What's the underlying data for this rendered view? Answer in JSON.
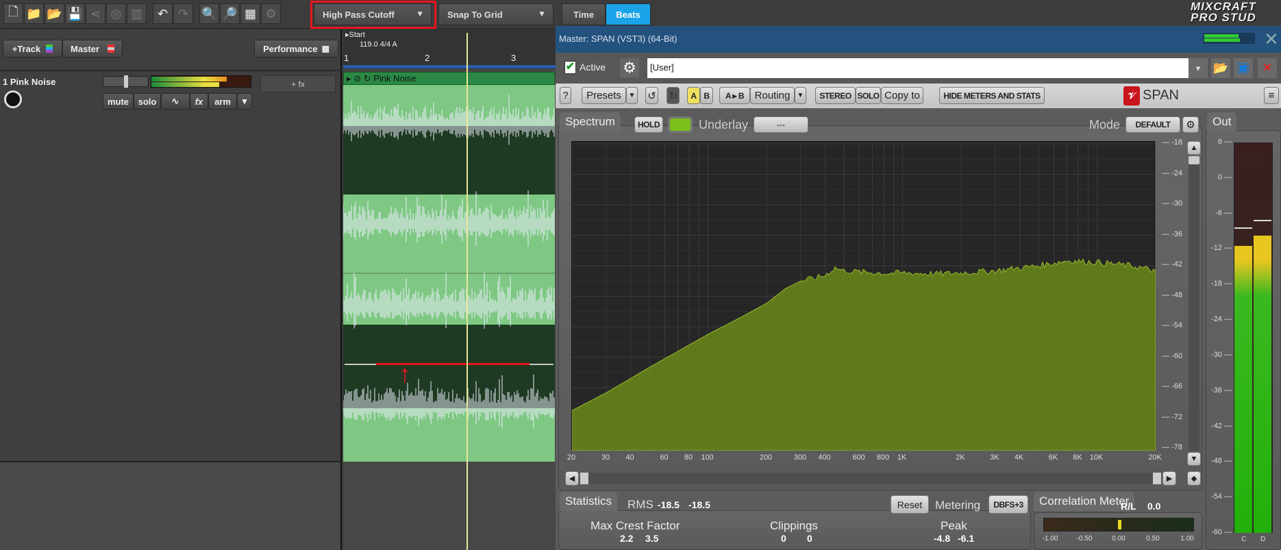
{
  "toolbar": {
    "icons": [
      "new-file-icon",
      "open-folder-icon",
      "open-song-icon",
      "save-icon",
      "share-icon",
      "burn-cd-icon",
      "mixdown-icon",
      "undo-icon",
      "redo-icon",
      "zoom-in-icon",
      "zoom-out-icon",
      "midi-icon",
      "settings-icon"
    ],
    "automation_dropdown": "High Pass Cutoff",
    "snap_dropdown": "Snap To Grid",
    "time_label": "Time",
    "beats_label": "Beats",
    "logo_text": "MIXCRAFT PRO STUDIO"
  },
  "tracks_panel": {
    "add_track": "+Track",
    "master": "Master",
    "performance": "Performance",
    "track": {
      "name": "1 Pink Noise",
      "mute": "mute",
      "solo": "solo",
      "fx": "fx",
      "arm": "arm",
      "add_fx": "+ fx"
    }
  },
  "timeline": {
    "start_label": "Start",
    "tempo": "119.0 4/4 A",
    "bars": [
      "1",
      "2",
      "3"
    ],
    "clip_name": "Pink Noise"
  },
  "plugin": {
    "title": "Master: SPAN (VST3) (64-Bit)",
    "active_label": "Active",
    "active": true,
    "preset_value": "[User]",
    "buttons": {
      "help": "?",
      "presets": "Presets",
      "a": "A",
      "b": "B",
      "a_to_b": "A ▸ B",
      "routing": "Routing",
      "stereo": "STEREO",
      "solo": "SOLO",
      "copy_to": "Copy to",
      "hide_meters": "HIDE METERS AND STATS"
    },
    "brand": "SPAN",
    "spectrum_tab": "Spectrum",
    "hold": "HOLD",
    "underlay_label": "Underlay",
    "underlay_value": "---",
    "mode_label": "Mode",
    "mode_value": "DEFAULT",
    "out_tab": "Out",
    "statistics": {
      "tab": "Statistics",
      "rms_label": "RMS",
      "rms": [
        "-18.5",
        "-18.5"
      ],
      "reset": "Reset",
      "metering_label": "Metering",
      "metering_value": "DBFS+3",
      "crest_label": "Max Crest Factor",
      "crest": [
        "2.2",
        "3.5"
      ],
      "clippings_label": "Clippings",
      "clippings": [
        "0",
        "0"
      ],
      "peak_label": "Peak",
      "peak": [
        "-4.8",
        "-6.1"
      ]
    },
    "correlation": {
      "tab": "Correlation Meter",
      "rl_label": "R/L",
      "rl_value": "0.0",
      "scale": [
        "-1.00",
        "-0.50",
        "0.00",
        "0.50",
        "1.00"
      ],
      "value": 0.0
    },
    "out_meter": {
      "scale": [
        "6",
        "0",
        "-6",
        "-12",
        "-18",
        "-24",
        "-30",
        "-36",
        "-42",
        "-48",
        "-54",
        "-60"
      ],
      "channels": [
        "C",
        "D"
      ],
      "levels_db": [
        -11.5,
        -9.8
      ],
      "peaks_db": [
        -8.3,
        -7.1
      ]
    }
  },
  "chart_data": {
    "type": "area",
    "x_scale": "log",
    "xlim": [
      20,
      20000
    ],
    "ylim": [
      -78,
      -18
    ],
    "x_ticks": [
      "20",
      "30",
      "40",
      "60",
      "80",
      "100",
      "200",
      "300",
      "400",
      "600",
      "800",
      "1K",
      "2K",
      "3K",
      "4K",
      "6K",
      "8K",
      "10K",
      "20K"
    ],
    "y_ticks": [
      "-18",
      "-24",
      "-30",
      "-36",
      "-42",
      "-48",
      "-54",
      "-60",
      "-66",
      "-72",
      "-78"
    ],
    "grid": true,
    "color": "#6b8a1a",
    "series": [
      {
        "x": [
          20,
          30,
          50,
          100,
          150,
          200,
          250,
          300,
          350,
          400,
          450,
          500,
          600,
          800,
          1000,
          1500,
          2000,
          3000,
          5000,
          7000,
          10000,
          15000,
          20000
        ],
        "y": [
          -70.5,
          -67,
          -62,
          -55.5,
          -52,
          -49.4,
          -46.5,
          -45,
          -44.5,
          -43.9,
          -42.4,
          -43,
          -43.2,
          -43.5,
          -43.4,
          -43.6,
          -43.4,
          -43,
          -42,
          -41,
          -41.3,
          -42,
          -43
        ]
      }
    ]
  },
  "colors": {
    "accent_blue": "#1aa3e8",
    "plugin_title_bar": "#23527f",
    "clip_green": "#7ec883",
    "spectrum_fill": "#6b8a1a",
    "meter_yellow": "#e8c620",
    "highlight_red": "#e8141c"
  }
}
